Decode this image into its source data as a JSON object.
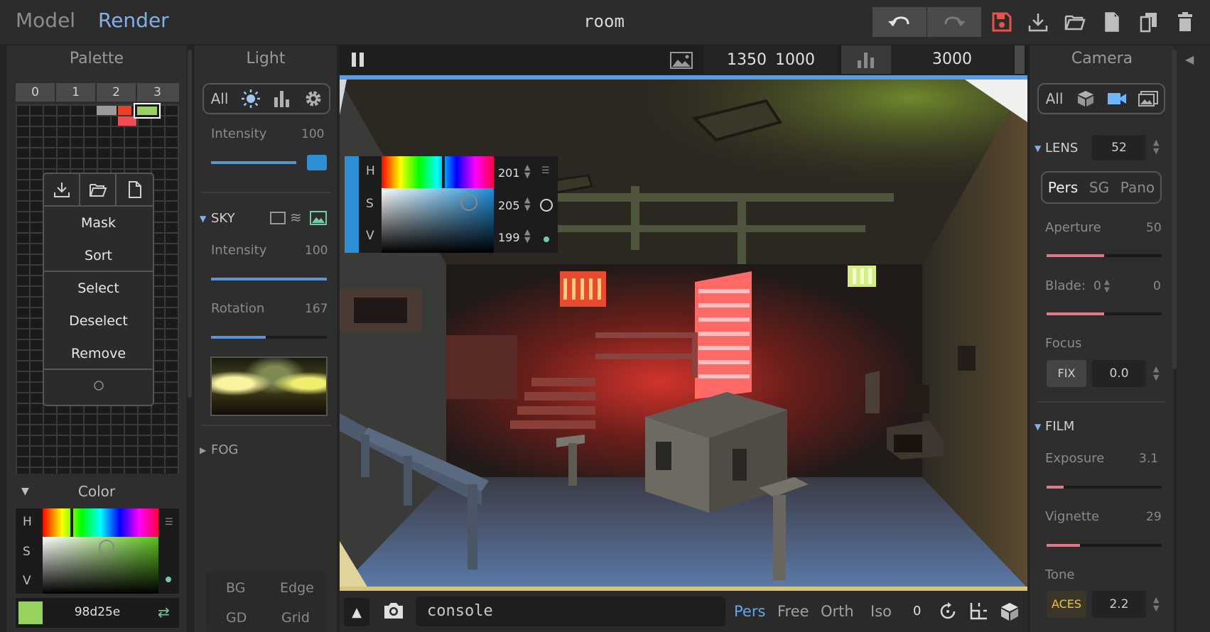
{
  "header": {
    "tab_model": "Model",
    "tab_render": "Render",
    "title": "room",
    "icons": [
      "undo-icon",
      "redo-icon",
      "save-icon",
      "download-icon",
      "open-folder-icon",
      "new-file-icon",
      "duplicate-icon",
      "trash-icon"
    ],
    "accent_save": "#e8524a"
  },
  "palette": {
    "title": "Palette",
    "tabs": [
      "0",
      "1",
      "2",
      "3"
    ],
    "menu": {
      "icons": [
        "download-icon",
        "open-folder-icon",
        "new-file-icon"
      ],
      "items": [
        "Mask",
        "Sort",
        "Select",
        "Deselect",
        "Remove"
      ]
    },
    "color_section": {
      "title": "Color",
      "labels": [
        "H",
        "S",
        "V"
      ],
      "hex": "98d25e",
      "swatch": "#98d25e"
    }
  },
  "light": {
    "title": "Light",
    "filter_all": "All",
    "intensity_label": "Intensity",
    "intensity_value": "100",
    "sky": {
      "label": "SKY",
      "intensity_label": "Intensity",
      "intensity_value": "100",
      "rotation_label": "Rotation",
      "rotation_value": "167",
      "rotation_level": 0.47
    },
    "fog_label": "FOG",
    "bottom_buttons": [
      "BG",
      "Edge",
      "GD",
      "Grid"
    ]
  },
  "viewport": {
    "width_value": "1350",
    "height_value": "1000",
    "samples": "3000",
    "console_placeholder": "console",
    "projections": [
      "Pers",
      "Free",
      "Orth",
      "Iso"
    ],
    "active_projection": "Pers",
    "counter": "0",
    "picker": {
      "labels": [
        "H",
        "S",
        "V"
      ],
      "values": [
        "201",
        "205",
        "199"
      ]
    }
  },
  "camera": {
    "title": "Camera",
    "filter_all": "All",
    "lens_label": "LENS",
    "lens_value": "52",
    "lens_modes": [
      "Pers",
      "SG",
      "Pano"
    ],
    "aperture_label": "Aperture",
    "aperture_value": "50",
    "aperture_level": 0.5,
    "blade_label": "Blade:",
    "blade_count": "0",
    "blade_value": "0",
    "focus_label": "Focus",
    "focus_fix": "FIX",
    "focus_value": "0.0",
    "film_label": "FILM",
    "exposure_label": "Exposure",
    "exposure_value": "3.1",
    "vignette_label": "Vignette",
    "vignette_value": "29",
    "tone_label": "Tone",
    "tone_mode": "ACES",
    "tone_value": "2.2",
    "accent": "#e07a8a"
  }
}
